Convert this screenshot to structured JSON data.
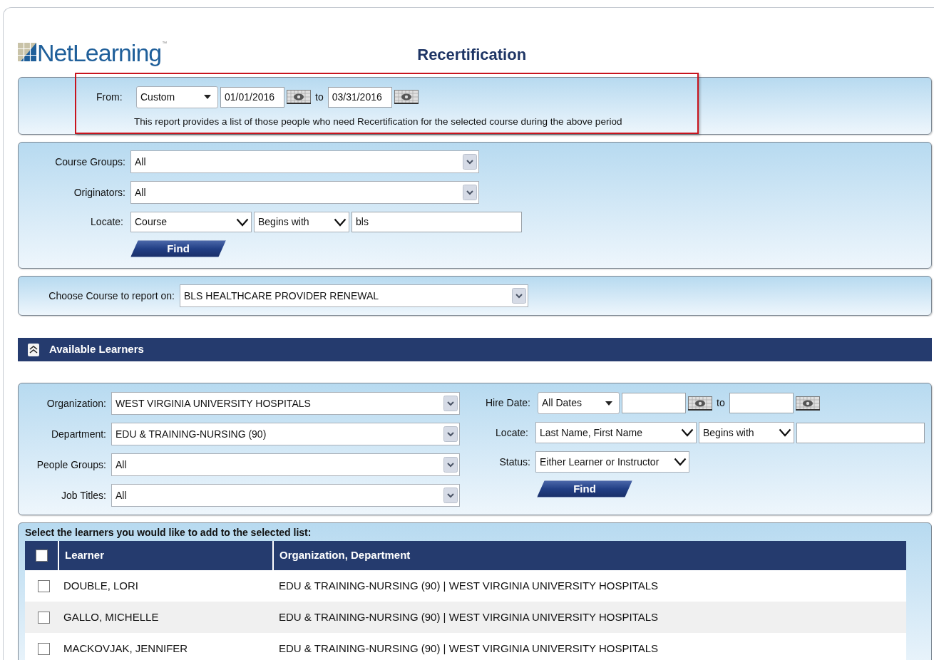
{
  "header": {
    "logo": "NetLearning",
    "logo_mark": "™",
    "title": "Recertification"
  },
  "period": {
    "from_label": "From:",
    "preset": "Custom",
    "start": "01/01/2016",
    "to_label": "to",
    "end": "03/31/2016",
    "note": "This report provides a list of those people who need Recertification for the selected course during the above period"
  },
  "course_filters": {
    "fields": [
      {
        "label": "Course Groups:",
        "value": "All"
      },
      {
        "label": "Originators:",
        "value": "All"
      }
    ],
    "locate": {
      "label": "Locate:",
      "field": "Course",
      "match": "Begins with",
      "query": "bls"
    },
    "find": "Find"
  },
  "course_choice": {
    "label": "Choose Course to report on:",
    "value": "BLS HEALTHCARE PROVIDER RENEWAL"
  },
  "section": {
    "title": "Available Learners",
    "expanded": true
  },
  "learner_filters": {
    "fields": [
      {
        "label": "Organization:",
        "value": "WEST VIRGINIA UNIVERSITY HOSPITALS"
      },
      {
        "label": "Department:",
        "value": "EDU & TRAINING-NURSING (90)"
      },
      {
        "label": "People Groups:",
        "value": "All"
      },
      {
        "label": "Job Titles:",
        "value": "All"
      }
    ],
    "hire_date": {
      "label": "Hire Date:",
      "preset": "All Dates",
      "to_label": "to"
    },
    "locate": {
      "label": "Locate:",
      "field": "Last Name, First Name",
      "match": "Begins with"
    },
    "status": {
      "label": "Status:",
      "value": "Either Learner or Instructor"
    },
    "find": "Find"
  },
  "learners": {
    "prompt": "Select the learners you would like to add to the selected list:",
    "columns": [
      "Learner",
      "Organization, Department"
    ],
    "select_all_checked": false,
    "rows": [
      {
        "learner": "DOUBLE, LORI",
        "org": "EDU & TRAINING-NURSING (90) | WEST VIRGINIA UNIVERSITY HOSPITALS",
        "checked": false
      },
      {
        "learner": "GALLO, MICHELLE",
        "org": "EDU & TRAINING-NURSING (90) | WEST VIRGINIA UNIVERSITY HOSPITALS",
        "checked": false
      },
      {
        "learner": "MACKOVJAK, JENNIFER",
        "org": "EDU & TRAINING-NURSING (90) | WEST VIRGINIA UNIVERSITY HOSPITALS",
        "checked": false
      }
    ]
  }
}
